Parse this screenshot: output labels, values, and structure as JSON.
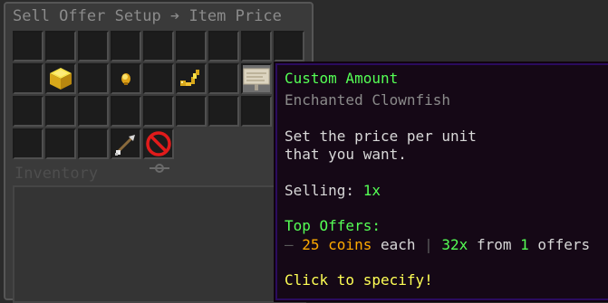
{
  "window": {
    "title": "Sell Offer Setup ➔ Item Price",
    "inventory_label": "Inventory"
  },
  "slots": {
    "gold_block": "gold-block-item",
    "gold_nugget": "gold-nugget-item",
    "golden_horn": "golden-horn-item",
    "sign": "oak-sign-item",
    "arrow": "arrow-item",
    "barrier": "barrier-item"
  },
  "tooltip": {
    "title": "Custom Amount",
    "subtitle": "Enchanted Clownfish",
    "desc_1": "Set the price per unit",
    "desc_2": "that you want.",
    "selling_label": "Selling: ",
    "selling_value": "1x",
    "top_offers": "Top Offers:",
    "offer_dash": "— ",
    "offer_price": "25 coins",
    "offer_each": " each",
    "offer_sep": " | ",
    "offer_amount": "32x",
    "offer_from": " from ",
    "offer_count": "1",
    "offer_offers": " offers",
    "action": "Click to specify!"
  },
  "colors": {
    "title_green": "#55ff55",
    "gold": "#ffaa00",
    "action_yellow": "#ffff55",
    "tooltip_bg": "#150816",
    "tooltip_border": "#2a0b5e"
  }
}
